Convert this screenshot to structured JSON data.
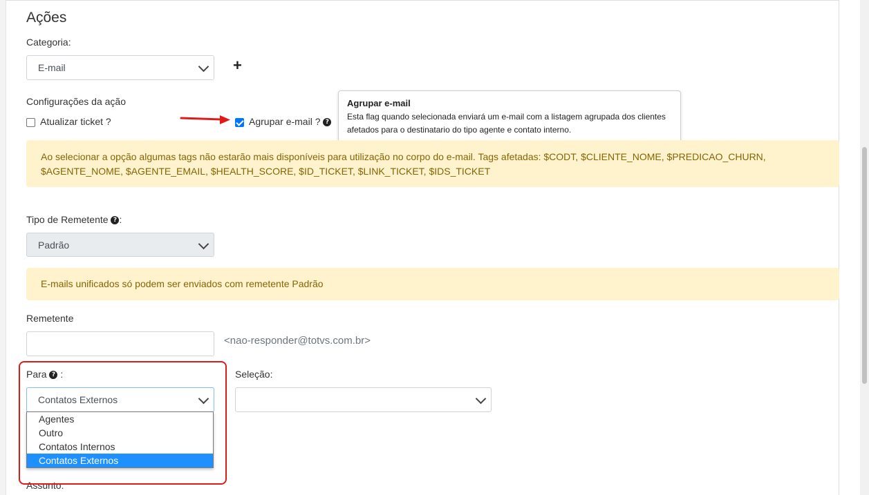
{
  "section": {
    "title": "Ações"
  },
  "category": {
    "label": "Categoria:",
    "value": "E-mail",
    "add_icon": "+"
  },
  "config": {
    "label": "Configurações da ação",
    "atualizar_ticket": {
      "label": "Atualizar ticket ?",
      "checked": false
    },
    "agrupar_email": {
      "label": "Agrupar e-mail ?",
      "checked": true
    }
  },
  "tooltip": {
    "title": "Agrupar e-mail",
    "body": "Esta flag quando selecionada enviará um e-mail com a listagem agrupada dos clientes afetados para o destinatario do tipo agente e contato interno."
  },
  "alert_tags": "Ao selecionar a opção algumas tags não estarão mais disponíveis para utilização no corpo do e-mail. Tags afetadas: $CODT, $CLIENTE_NOME, $PREDICAO_CHURN, $AGENTE_NOME, $AGENTE_EMAIL, $HEALTH_SCORE, $ID_TICKET, $LINK_TICKET, $IDS_TICKET",
  "sender_type": {
    "label": "Tipo de Remetente",
    "suffix": ":",
    "value": "Padrão"
  },
  "alert_sender": "E-mails unificados só podem ser enviados com remetente Padrão",
  "remetente": {
    "label": "Remetente",
    "value": "",
    "email_hint": "<nao-responder@totvs.com.br>"
  },
  "para": {
    "label": "Para",
    "suffix": ":",
    "value": "Contatos Externos",
    "options": [
      "Agentes",
      "Outro",
      "Contatos Internos",
      "Contatos Externos"
    ],
    "selected_index": 3
  },
  "selecao": {
    "label": "Seleção:",
    "value": ""
  },
  "assunto": {
    "label": "Assunto:"
  },
  "icons": {
    "help": "question-circle-icon",
    "arrow": "red-arrow-annotation",
    "chevron": "chevron-down-icon"
  },
  "colors": {
    "alert_bg": "#fff3cd",
    "alert_text": "#856404",
    "highlight_border": "#e01919",
    "arrow": "#e01919",
    "selected_option": "#1e90ff",
    "checkbox": "#0075ff"
  }
}
